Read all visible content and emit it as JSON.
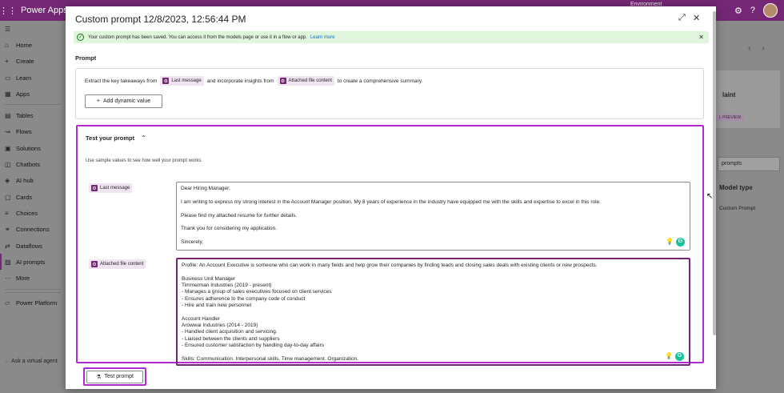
{
  "app": {
    "name": "Power Apps",
    "environment": "Environment"
  },
  "nav": {
    "items": [
      {
        "icon": "home-icon",
        "glyph": "⌂",
        "label": "Home"
      },
      {
        "icon": "plus-icon",
        "glyph": "+",
        "label": "Create"
      },
      {
        "icon": "book-icon",
        "glyph": "▭",
        "label": "Learn"
      },
      {
        "icon": "apps-icon",
        "glyph": "▦",
        "label": "Apps"
      },
      {
        "icon": "table-icon",
        "glyph": "▤",
        "label": "Tables"
      },
      {
        "icon": "flow-icon",
        "glyph": "↝",
        "label": "Flows"
      },
      {
        "icon": "solution-icon",
        "glyph": "▣",
        "label": "Solutions"
      },
      {
        "icon": "chatbot-icon",
        "glyph": "◫",
        "label": "Chatbots"
      },
      {
        "icon": "ai-hub-icon",
        "glyph": "◈",
        "label": "AI hub"
      },
      {
        "icon": "cards-icon",
        "glyph": "▢",
        "label": "Cards"
      },
      {
        "icon": "choices-icon",
        "glyph": "≡",
        "label": "Choices"
      },
      {
        "icon": "connections-icon",
        "glyph": "⚭",
        "label": "Connections"
      },
      {
        "icon": "dataflows-icon",
        "glyph": "⇄",
        "label": "Dataflows"
      },
      {
        "icon": "ai-prompts-icon",
        "glyph": "▨",
        "label": "AI prompts"
      },
      {
        "icon": "more-icon",
        "glyph": "···",
        "label": "More"
      }
    ],
    "platform": "Power Platform",
    "ask": "Ask a virtual agent"
  },
  "background": {
    "card_title": "laint",
    "card_badge": "L PREVIEW",
    "search": "prompts",
    "column": "Model type",
    "cell": "Custom Prompt"
  },
  "modal": {
    "title": "Custom prompt 12/8/2023, 12:56:44 PM",
    "banner_text": "Your custom prompt has been saved. You can access it from the models page or use it in a flow or app.",
    "banner_link": "Learn more",
    "prompt_label": "Prompt",
    "prompt": {
      "part1": "Extract the key takeaways from",
      "chip1": "Last message",
      "part2": "and incorporate insights from",
      "chip2": "Attached file content",
      "part3": "to create a comprehensive summary."
    },
    "add_dynamic": "Add dynamic value",
    "test_title": "Test your prompt",
    "test_sub": "Use sample values to see how well your prompt works.",
    "input1_label": "Last message",
    "input1_lines": [
      "Dear Hiring Manager,",
      "",
      "I am writing to express my strong interest in the Account Manager position. My 8 years of experience in the industry have equipped me with the skills and expertise to excel in this role.",
      "",
      "Please find my attached resume for further details.",
      "",
      "Thank you for considering my application.",
      "",
      "Sincerely,"
    ],
    "input2_label": "Attached file content",
    "input2_lines": [
      "Profile: An Account Executive is someone who can work in many fields and help grow their companies by finding leads and closing sales deals with existing clients or new prospects.",
      "",
      "Business Unit Manager",
      "Timmerman Industries (2019 - present)",
      "- Manages a group of sales executives focused on client services",
      "- Ensures adherence to the company code of conduct",
      "- Hire and train new personnel",
      "",
      "Account Handler",
      "Arowwai Industries (2014 - 2019)",
      "- Handled client acquisition and servicing.",
      "- Liaised between the clients and suppliers",
      "- Ensured customer satisfaction by handling day-to-day affairs",
      "",
      "Skills: Communication. Interpersonal skills. Time management. Organization."
    ],
    "test_button": "Test prompt"
  }
}
